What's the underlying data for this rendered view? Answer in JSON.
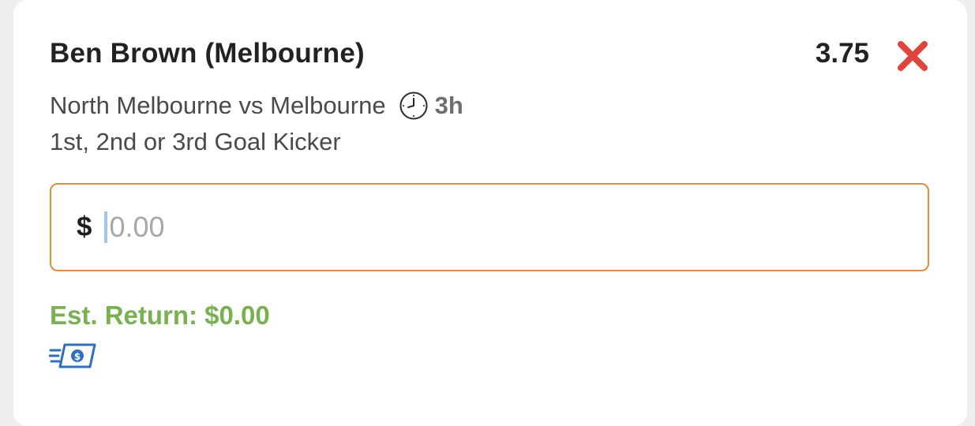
{
  "selection": {
    "title": "Ben Brown (Melbourne)",
    "odds": "3.75",
    "match": "North Melbourne vs Melbourne",
    "time_to_start": "3h",
    "market": "1st, 2nd or 3rd Goal Kicker"
  },
  "stake": {
    "currency_symbol": "$",
    "value": "",
    "placeholder": "0.00"
  },
  "estimated_return": "Est. Return: $0.00",
  "icons": {
    "remove": "close-x-icon",
    "clock": "clock-icon",
    "cash": "fast-cash-icon"
  },
  "colors": {
    "remove_red": "#e0443a",
    "input_border_orange": "#f0892f",
    "return_green": "#77b150",
    "cash_icon_blue": "#2f6ec0"
  }
}
